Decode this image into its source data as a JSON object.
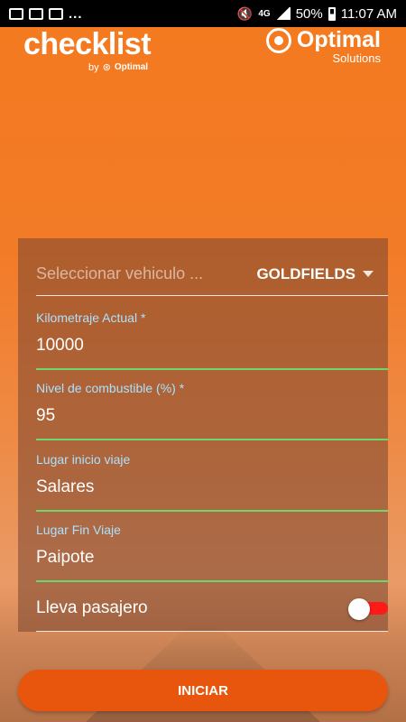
{
  "status_bar": {
    "more": "...",
    "network": "4G",
    "battery": "50%",
    "time": "11:07 AM",
    "icons": [
      "image-icon",
      "image-icon",
      "mail-icon",
      "mute-icon",
      "signal-icon",
      "battery-icon"
    ]
  },
  "brand": {
    "logo": "checklist",
    "by": "by",
    "by_brand": "Optimal",
    "partner_name": "Optimal",
    "partner_tag": "Solutions"
  },
  "form": {
    "vehicle": {
      "placeholder": "Seleccionar vehiculo  ...",
      "selected": "GOLDFIELDS"
    },
    "fields": [
      {
        "label": "Kilometraje Actual *",
        "value": "10000"
      },
      {
        "label": "Nivel de combustible (%) *",
        "value": "95"
      },
      {
        "label": "Lugar inicio viaje",
        "value": "Salares"
      },
      {
        "label": "Lugar Fin Viaje",
        "value": "Paipote"
      }
    ],
    "passenger": {
      "label": "Lleva pasajero",
      "checked": false,
      "track_color": "#ff1a1a"
    }
  },
  "actions": {
    "start_label": "INICIAR"
  },
  "colors": {
    "accent": "#e7560c",
    "field_underline": "#6cd86c",
    "label": "#a9e2ff"
  }
}
